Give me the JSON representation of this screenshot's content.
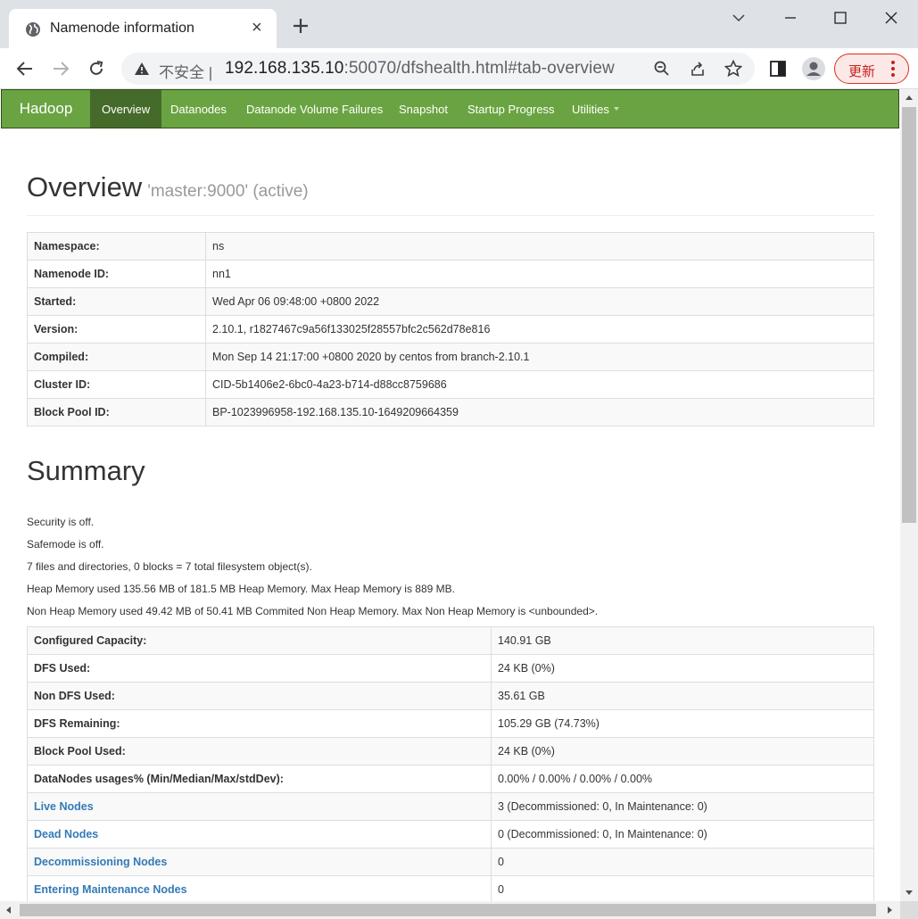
{
  "browser": {
    "tab_title": "Namenode information",
    "tab_close": "×",
    "security_label": "不安全",
    "url_host": "192.168.135.10",
    "url_rest": ":50070/dfshealth.html#tab-overview",
    "update_label": "更新",
    "accent": "#d93025"
  },
  "navbar": {
    "brand": "Hadoop",
    "items": [
      "Overview",
      "Datanodes",
      "Datanode Volume Failures",
      "Snapshot",
      "Startup Progress",
      "Utilities"
    ],
    "active": "Overview",
    "color": "#6aa442"
  },
  "overview": {
    "title": "Overview",
    "subtitle": "'master:9000' (active)",
    "rows": [
      {
        "key": "Namespace:",
        "value": "ns"
      },
      {
        "key": "Namenode ID:",
        "value": "nn1"
      },
      {
        "key": "Started:",
        "value": "Wed Apr 06 09:48:00 +0800 2022"
      },
      {
        "key": "Version:",
        "value": "2.10.1, r1827467c9a56f133025f28557bfc2c562d78e816"
      },
      {
        "key": "Compiled:",
        "value": "Mon Sep 14 21:17:00 +0800 2020 by centos from branch-2.10.1"
      },
      {
        "key": "Cluster ID:",
        "value": "CID-5b1406e2-6bc0-4a23-b714-d88cc8759686"
      },
      {
        "key": "Block Pool ID:",
        "value": "BP-1023996958-192.168.135.10-1649209664359"
      }
    ]
  },
  "summary": {
    "title": "Summary",
    "lines": [
      "Security is off.",
      "Safemode is off.",
      "7 files and directories, 0 blocks = 7 total filesystem object(s).",
      "Heap Memory used 135.56 MB of 181.5 MB Heap Memory. Max Heap Memory is 889 MB.",
      "Non Heap Memory used 49.42 MB of 50.41 MB Commited Non Heap Memory. Max Non Heap Memory is <unbounded>."
    ],
    "rows": [
      {
        "key": "Configured Capacity:",
        "value": "140.91 GB"
      },
      {
        "key": "DFS Used:",
        "value": "24 KB (0%)"
      },
      {
        "key": "Non DFS Used:",
        "value": "35.61 GB"
      },
      {
        "key": "DFS Remaining:",
        "value": "105.29 GB (74.73%)"
      },
      {
        "key": "Block Pool Used:",
        "value": "24 KB (0%)"
      },
      {
        "key": "DataNodes usages% (Min/Median/Max/stdDev):",
        "value": "0.00% / 0.00% / 0.00% / 0.00%"
      },
      {
        "key": "Live Nodes",
        "value": "3 (Decommissioned: 0, In Maintenance: 0)"
      },
      {
        "key": "Dead Nodes",
        "value": "0 (Decommissioned: 0, In Maintenance: 0)"
      },
      {
        "key": "Decommissioning Nodes",
        "value": "0"
      },
      {
        "key": "Entering Maintenance Nodes",
        "value": "0"
      }
    ]
  }
}
